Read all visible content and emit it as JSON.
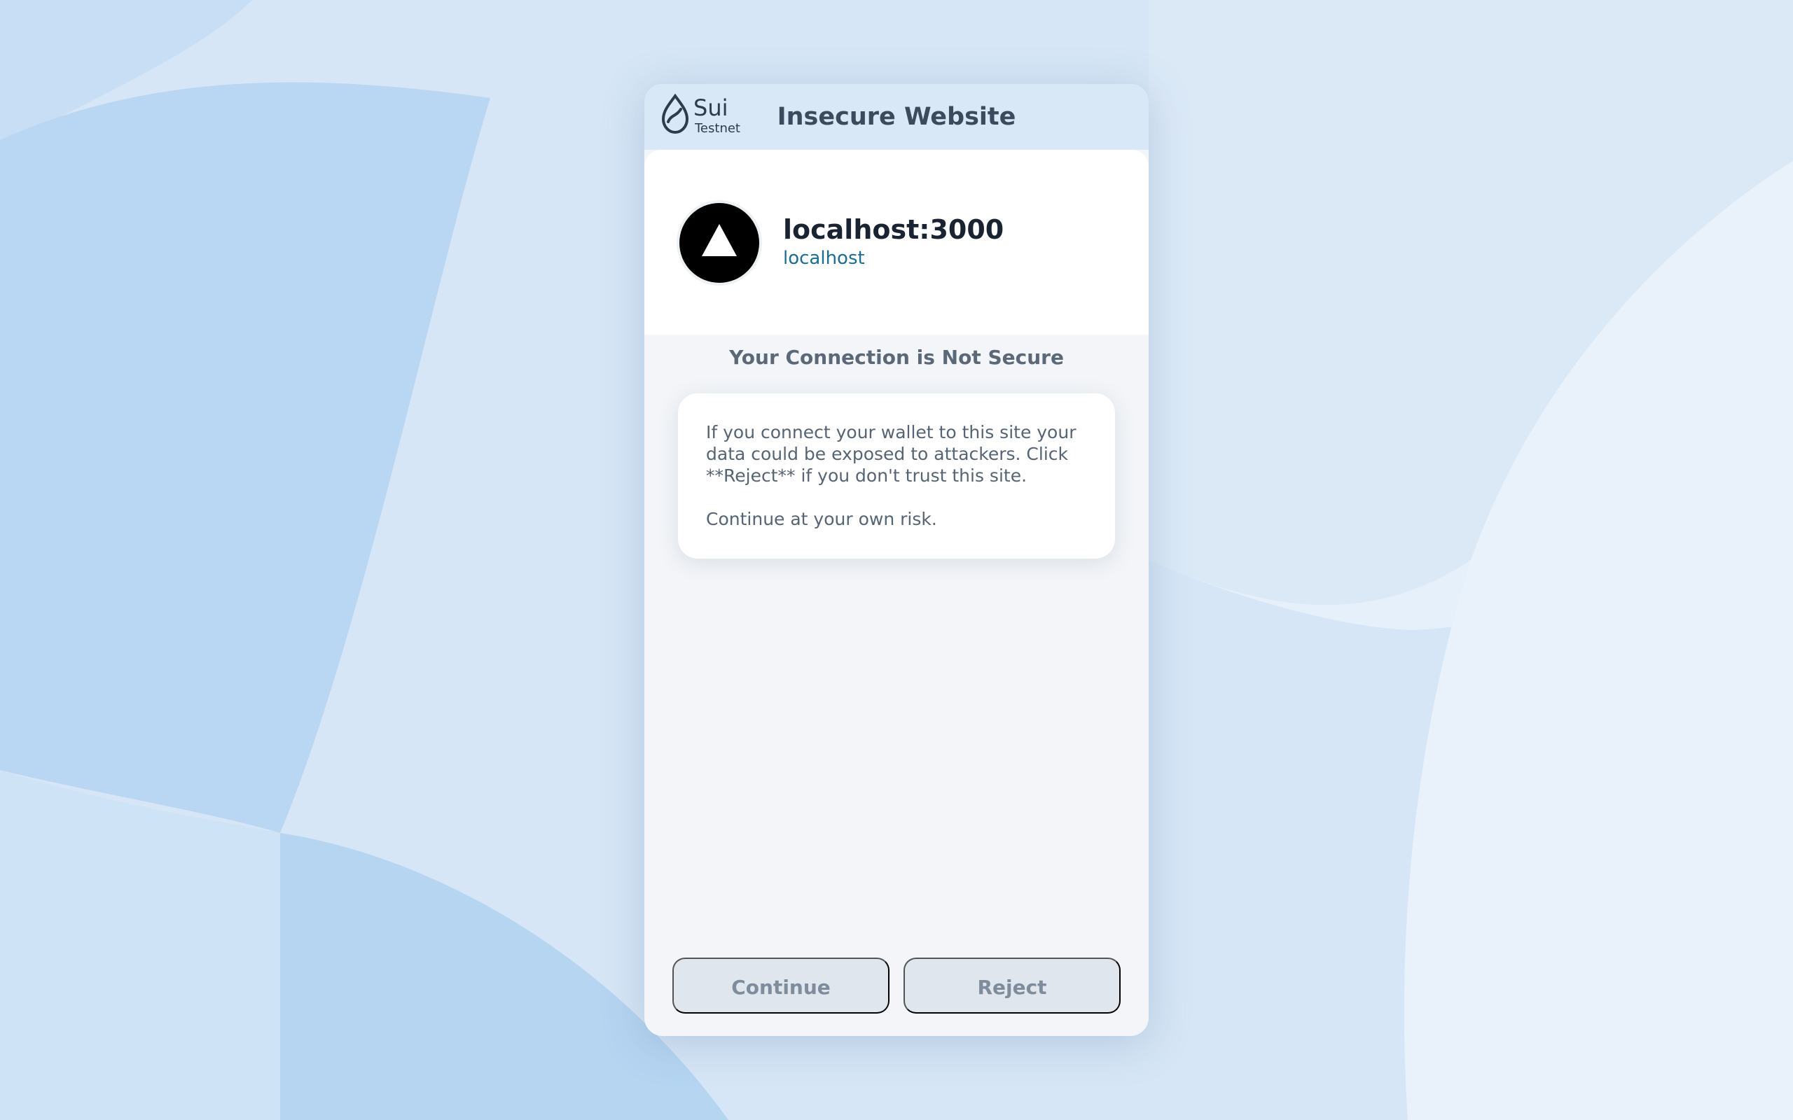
{
  "header": {
    "logo_name": "Sui",
    "network": "Testnet",
    "title": "Insecure Website"
  },
  "site": {
    "name": "localhost:3000",
    "host": "localhost",
    "icon": "triangle-logo-icon"
  },
  "warning": {
    "title": "Your Connection is Not Secure",
    "message": "If you connect your wallet to this site your data could be exposed to attackers. Click **Reject** if you don't trust this site.",
    "note": "Continue at your own risk."
  },
  "actions": {
    "continue_label": "Continue",
    "reject_label": "Reject"
  },
  "colors": {
    "background": "#d6e6f6",
    "header": "#d8e8f6",
    "panel": "#f3f5f8",
    "host_link": "#1d6d93",
    "button_bg": "#e0e6ed",
    "button_text": "#7f8c9b"
  }
}
